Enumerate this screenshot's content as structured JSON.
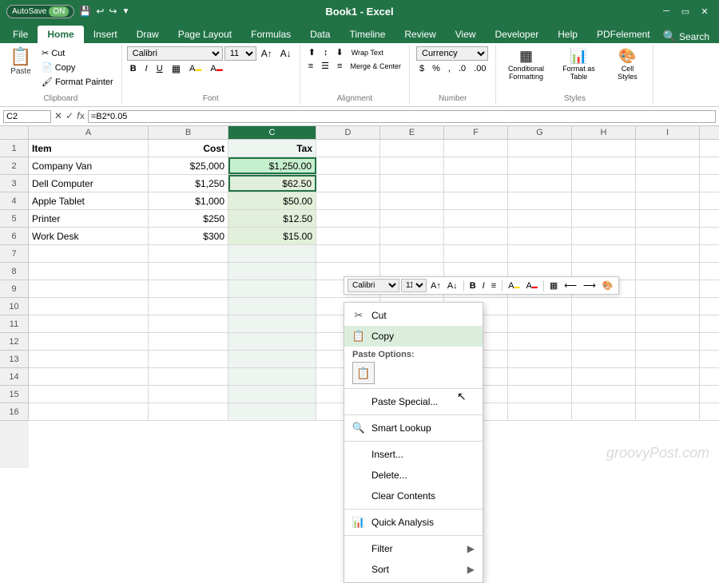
{
  "titleBar": {
    "autosave": "AutoSave",
    "autosave_state": "ON",
    "title": "Book1 - Excel",
    "save_icon": "💾",
    "undo_icon": "↩",
    "redo_icon": "↪"
  },
  "ribbonTabs": [
    "File",
    "Home",
    "Insert",
    "Draw",
    "Page Layout",
    "Formulas",
    "Data",
    "Timeline",
    "Review",
    "View",
    "Developer",
    "Help",
    "PDFelement"
  ],
  "activeTab": "Home",
  "clipboard": {
    "label": "Clipboard",
    "paste_label": "Paste",
    "cut_label": "Cut",
    "copy_label": "Copy",
    "format_painter_label": "Format Painter"
  },
  "font": {
    "label": "Font",
    "name": "Calibri",
    "size": "11"
  },
  "alignment": {
    "label": "Alignment",
    "wrap_text": "Wrap Text",
    "merge_center": "Merge & Center"
  },
  "number": {
    "label": "Number",
    "format": "Currency"
  },
  "styles": {
    "label": "Styles",
    "conditional_formatting": "Conditional Formatting",
    "format_as_table": "Format as Table",
    "cell_styles": "Cell Styles"
  },
  "formulaBar": {
    "nameBox": "C2",
    "formula": "=B2*0.05"
  },
  "columns": [
    "A",
    "B",
    "C",
    "D",
    "E",
    "F",
    "G",
    "H",
    "I"
  ],
  "rows": [
    {
      "row": 1,
      "cells": [
        "Item",
        "Cost",
        "Tax",
        "",
        "",
        "",
        "",
        "",
        ""
      ]
    },
    {
      "row": 2,
      "cells": [
        "Company Van",
        "$25,000",
        "$1,250.00",
        "",
        "",
        "",
        "",
        "",
        ""
      ]
    },
    {
      "row": 3,
      "cells": [
        "Dell Computer",
        "$1,250",
        "$62.50",
        "",
        "",
        "",
        "",
        "",
        ""
      ]
    },
    {
      "row": 4,
      "cells": [
        "Apple Tablet",
        "$1,000",
        "$50.00",
        "",
        "",
        "",
        "",
        "",
        ""
      ]
    },
    {
      "row": 5,
      "cells": [
        "Printer",
        "$250",
        "$12.50",
        "",
        "",
        "",
        "",
        "",
        ""
      ]
    },
    {
      "row": 6,
      "cells": [
        "Work Desk",
        "$300",
        "$15.00",
        "",
        "",
        "",
        "",
        "",
        ""
      ]
    },
    {
      "row": 7,
      "cells": [
        "",
        "",
        "",
        "",
        "",
        "",
        "",
        "",
        ""
      ]
    },
    {
      "row": 8,
      "cells": [
        "",
        "",
        "",
        "",
        "",
        "",
        "",
        "",
        ""
      ]
    },
    {
      "row": 9,
      "cells": [
        "",
        "",
        "",
        "",
        "",
        "",
        "",
        "",
        ""
      ]
    },
    {
      "row": 10,
      "cells": [
        "",
        "",
        "",
        "",
        "",
        "",
        "",
        "",
        ""
      ]
    },
    {
      "row": 11,
      "cells": [
        "",
        "",
        "",
        "",
        "",
        "",
        "",
        "",
        ""
      ]
    },
    {
      "row": 12,
      "cells": [
        "",
        "",
        "",
        "",
        "",
        "",
        "",
        "",
        ""
      ]
    },
    {
      "row": 13,
      "cells": [
        "",
        "",
        "",
        "",
        "",
        "",
        "",
        "",
        ""
      ]
    },
    {
      "row": 14,
      "cells": [
        "",
        "",
        "",
        "",
        "",
        "",
        "",
        "",
        ""
      ]
    },
    {
      "row": 15,
      "cells": [
        "",
        "",
        "",
        "",
        "",
        "",
        "",
        "",
        ""
      ]
    },
    {
      "row": 16,
      "cells": [
        "",
        "",
        "",
        "",
        "",
        "",
        "",
        "",
        ""
      ]
    }
  ],
  "contextMenu": {
    "items": [
      {
        "label": "Cut",
        "icon": "✂",
        "hasSubmenu": false
      },
      {
        "label": "Copy",
        "icon": "📋",
        "hasSubmenu": false,
        "highlighted": true
      },
      {
        "label": "Paste Options:",
        "icon": "",
        "hasSubmenu": false,
        "isPasteSection": true
      },
      {
        "label": "Paste Special...",
        "icon": "",
        "hasSubmenu": false,
        "indent": true
      },
      {
        "label": "Smart Lookup",
        "icon": "🔍",
        "hasSubmenu": false
      },
      {
        "label": "Insert...",
        "icon": "",
        "hasSubmenu": false
      },
      {
        "label": "Delete...",
        "icon": "",
        "hasSubmenu": false
      },
      {
        "label": "Clear Contents",
        "icon": "",
        "hasSubmenu": false
      },
      {
        "label": "Quick Analysis",
        "icon": "📊",
        "hasSubmenu": false
      },
      {
        "label": "Filter",
        "icon": "",
        "hasSubmenu": true
      },
      {
        "label": "Sort",
        "icon": "",
        "hasSubmenu": true
      }
    ]
  },
  "miniToolbar": {
    "font": "Calibri",
    "size": "11"
  },
  "watermark": "groovyPost.com",
  "searchLabel": "Search"
}
